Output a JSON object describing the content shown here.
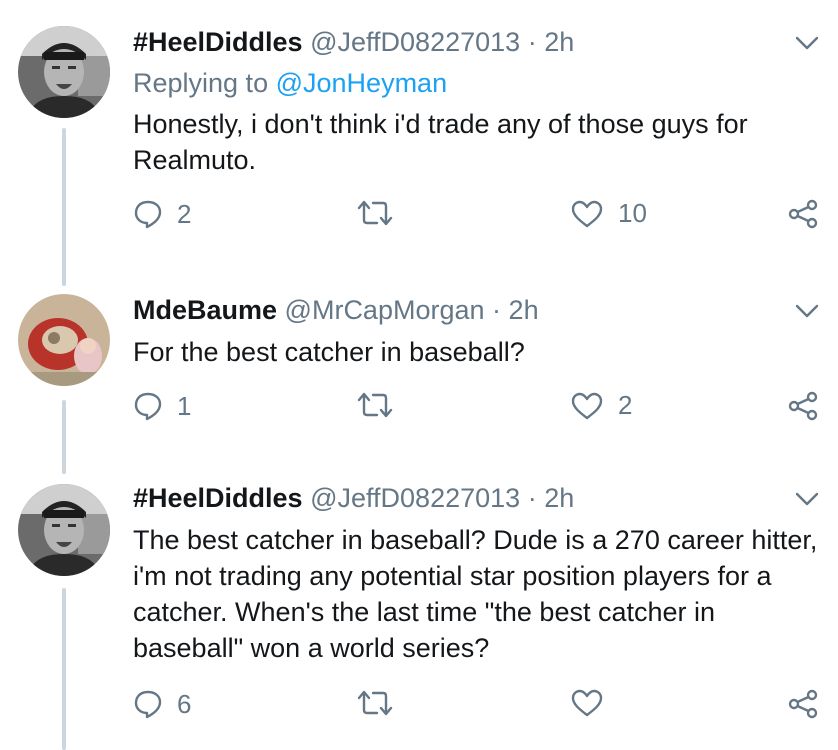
{
  "tweets": [
    {
      "display_name": "#HeelDiddles",
      "handle": "@JeffD08227013",
      "time": "2h",
      "replying_label": "Replying to",
      "replying_to": "@JonHeyman",
      "text": "Honestly, i don't think i'd trade any of those guys for Realmuto.",
      "replies": "2",
      "retweets": "",
      "likes": "10"
    },
    {
      "display_name": "MdeBaume",
      "handle": "@MrCapMorgan",
      "time": "2h",
      "text": "For the best catcher in baseball?",
      "replies": "1",
      "retweets": "",
      "likes": "2"
    },
    {
      "display_name": "#HeelDiddles",
      "handle": "@JeffD08227013",
      "time": "2h",
      "text": "The best catcher in baseball? Dude is a 270 career hitter, i'm not trading any potential star position players for a catcher. When's the last time \"the best catcher in baseball\" won a world series?",
      "replies": "6",
      "retweets": "",
      "likes": ""
    }
  ],
  "separator": "·",
  "icons": [
    "reply-icon",
    "retweet-icon",
    "like-icon",
    "share-icon",
    "chevron-down-icon"
  ],
  "colors": {
    "text": "#14171a",
    "muted": "#657786",
    "link": "#1da1f2",
    "thread_line": "#cdd6dd"
  }
}
